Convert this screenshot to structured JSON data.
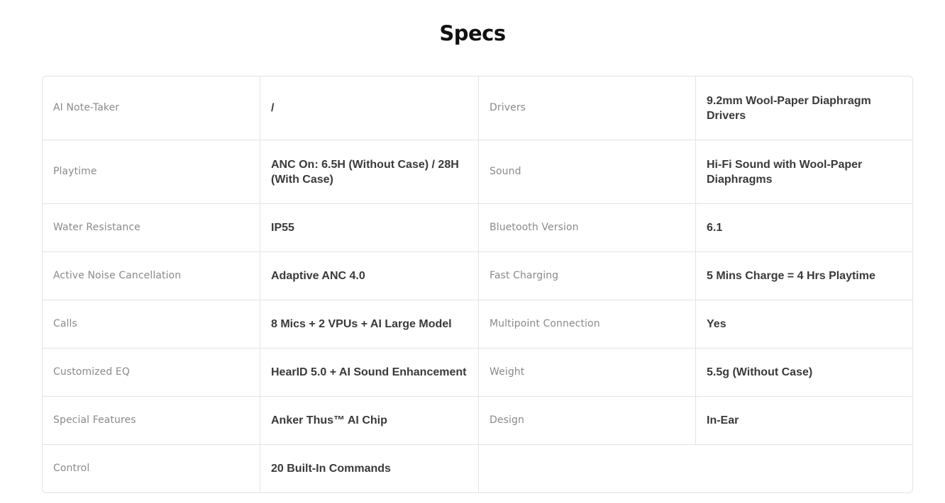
{
  "page": {
    "title": "Specs"
  },
  "specs": {
    "rows": [
      {
        "label_a": "AI Note-Taker",
        "value_a": "/",
        "label_b": "Drivers",
        "value_b": "9.2mm Wool-Paper Diaphragm Drivers"
      },
      {
        "label_a": "Playtime",
        "value_a": "ANC On: 6.5H (Without Case) / 28H (With Case)",
        "label_b": "Sound",
        "value_b": "Hi-Fi Sound with Wool-Paper Diaphragms"
      },
      {
        "label_a": "Water Resistance",
        "value_a": "IP55",
        "label_b": "Bluetooth Version",
        "value_b": "6.1"
      },
      {
        "label_a": "Active Noise Cancellation",
        "value_a": "Adaptive ANC 4.0",
        "label_b": "Fast Charging",
        "value_b": "5 Mins Charge = 4 Hrs Playtime"
      },
      {
        "label_a": "Calls",
        "value_a": "8 Mics + 2 VPUs + AI Large Model",
        "label_b": "Multipoint Connection",
        "value_b": "Yes"
      },
      {
        "label_a": "Customized EQ",
        "value_a": "HearID 5.0 + AI Sound Enhancement",
        "label_b": "Weight",
        "value_b": "5.5g (Without Case)"
      },
      {
        "label_a": "Special Features",
        "value_a": "Anker Thus™ AI Chip",
        "label_b": "Design",
        "value_b": "In-Ear"
      },
      {
        "label_a": "Control",
        "value_a": "20 Built-In Commands"
      }
    ]
  }
}
